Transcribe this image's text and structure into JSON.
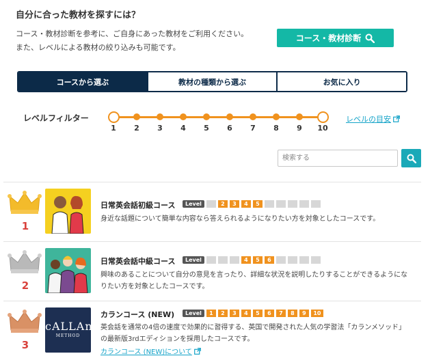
{
  "header": {
    "title": "自分に合った教材を探すには？",
    "desc_line1": "コース・教材診断を参考に、ご自身にあった教材をご利用ください。",
    "desc_line2": "また、レベルによる教材の絞り込みも可能です。",
    "diagnose_button": "コース・教材診断"
  },
  "tabs": [
    {
      "label": "コースから選ぶ",
      "active": true
    },
    {
      "label": "教材の種類から選ぶ",
      "active": false
    },
    {
      "label": "お気に入り",
      "active": false
    }
  ],
  "level_filter": {
    "label": "レベルフィルター",
    "levels": [
      "1",
      "2",
      "3",
      "4",
      "5",
      "6",
      "7",
      "8",
      "9",
      "10"
    ],
    "range": [
      1,
      10
    ],
    "guide_link": "レベルの目安"
  },
  "search": {
    "placeholder": "検索する"
  },
  "courses": [
    {
      "rank": "1",
      "crown": "gold",
      "title": "日常英会話初級コース",
      "level_tag": "Level",
      "levels_on": [
        2,
        3,
        4,
        5
      ],
      "level_labels": [
        "2",
        "3",
        "4",
        "5"
      ],
      "desc_line1": "身近な話題について簡単な内容なら答えられるようになりたい方を対象としたコースです。",
      "desc_line2": ""
    },
    {
      "rank": "2",
      "crown": "silver",
      "title": "日常英会話中級コース",
      "level_tag": "Level",
      "levels_on": [
        4,
        5,
        6
      ],
      "level_labels": [
        "4",
        "5",
        "6"
      ],
      "desc_line1": "興味のあることについて自分の意見を言ったり、詳細な状況を説明したりすることができるようにな",
      "desc_line2": "りたい方を対象としたコースです。"
    },
    {
      "rank": "3",
      "crown": "bronze",
      "title": "カランコース (NEW)",
      "level_tag": "Level",
      "levels_on": [
        1,
        2,
        3,
        4,
        5,
        6,
        7,
        8,
        9,
        10
      ],
      "level_labels": [
        "1",
        "2",
        "3",
        "4",
        "5",
        "6",
        "7",
        "8",
        "9",
        "10"
      ],
      "desc_line1": "英会話を通常の4倍の速度で効果的に習得する、英国で開発された人気の学習法「カランメソッド」",
      "desc_line2": "の最新版3rdエディションを採用したコースです。",
      "link": "カランコース (NEW)について",
      "logo_text": "cALLAn",
      "logo_sub": "METHOD"
    }
  ],
  "colors": {
    "accent_orange": "#f0921e",
    "teal": "#14b8a6",
    "navy": "#0c2a48",
    "rank_red": "#d9423c",
    "link_blue": "#14a3c8"
  }
}
